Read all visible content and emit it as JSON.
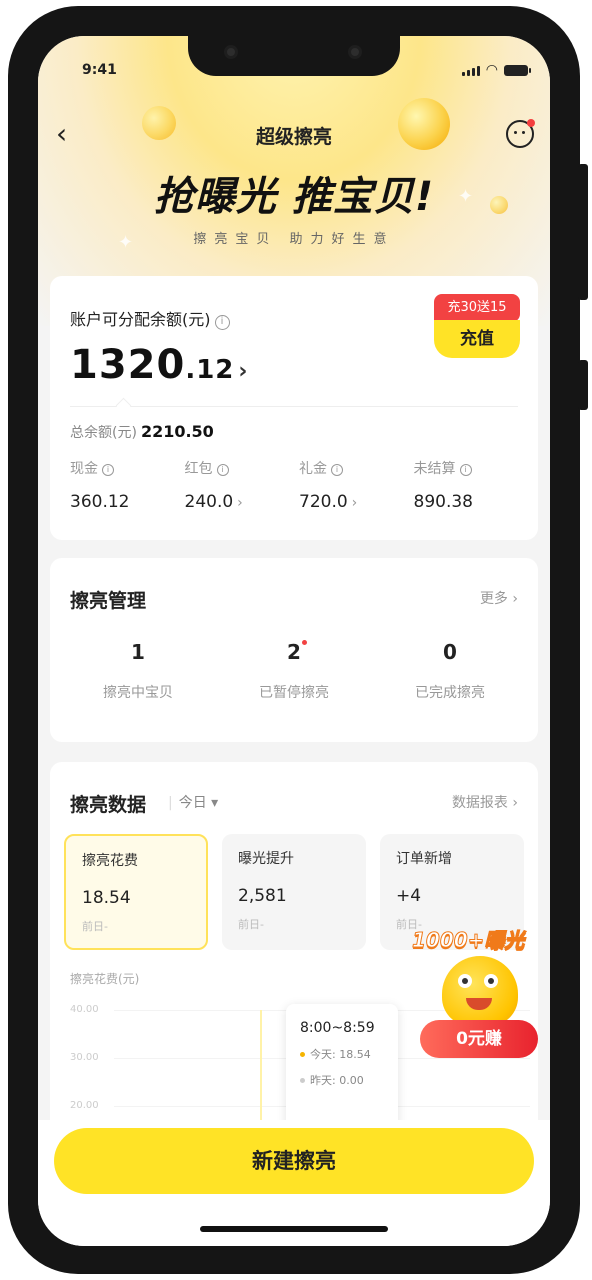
{
  "status_bar": {
    "time": "9:41"
  },
  "nav": {
    "title": "超级擦亮"
  },
  "hero": {
    "slogan": "抢曝光 推宝贝!",
    "sub_slogan": "擦亮宝贝 助力好生意"
  },
  "account": {
    "label": "账户可分配余额(元)",
    "amount_int": "1320",
    "amount_dec": ".12",
    "promo_badge": "充30送15",
    "recharge_label": "充值",
    "total_label": "总余额(元)",
    "total_value": "2210.50",
    "items": [
      {
        "label": "现金",
        "value": "360.12",
        "arrow": ""
      },
      {
        "label": "红包",
        "value": "240.0",
        "arrow": "›"
      },
      {
        "label": "礼金",
        "value": "720.0",
        "arrow": "›"
      },
      {
        "label": "未结算",
        "value": "890.38",
        "arrow": ""
      }
    ]
  },
  "manage": {
    "title": "擦亮管理",
    "more": "更多 ›",
    "stats": [
      {
        "value": "1",
        "label": "擦亮中宝贝"
      },
      {
        "value": "2",
        "label": "已暂停擦亮"
      },
      {
        "value": "0",
        "label": "已完成擦亮"
      }
    ]
  },
  "data_section": {
    "title": "擦亮数据",
    "range": "今日",
    "report_link": "数据报表 ›",
    "metrics": [
      {
        "label": "擦亮花费",
        "value": "18.54",
        "sub": "前日-"
      },
      {
        "label": "曝光提升",
        "value": "2,581",
        "sub": "前日-"
      },
      {
        "label": "订单新增",
        "value": "+4",
        "sub": "前日-"
      }
    ],
    "chart_title": "擦亮花费(元)"
  },
  "chart_data": {
    "type": "line",
    "title": "擦亮花费(元)",
    "y_ticks": [
      "40.00",
      "30.00",
      "20.00"
    ],
    "tooltip": {
      "time": "8:00~8:59",
      "series": [
        {
          "name": "今天",
          "value": "18.54",
          "color": "#f5b400"
        },
        {
          "name": "昨天",
          "value": "0.00",
          "color": "#cccccc"
        }
      ]
    }
  },
  "floating_promo": {
    "title": "1000+曝光",
    "button": "0元赚"
  },
  "footer": {
    "primary_button": "新建擦亮"
  }
}
